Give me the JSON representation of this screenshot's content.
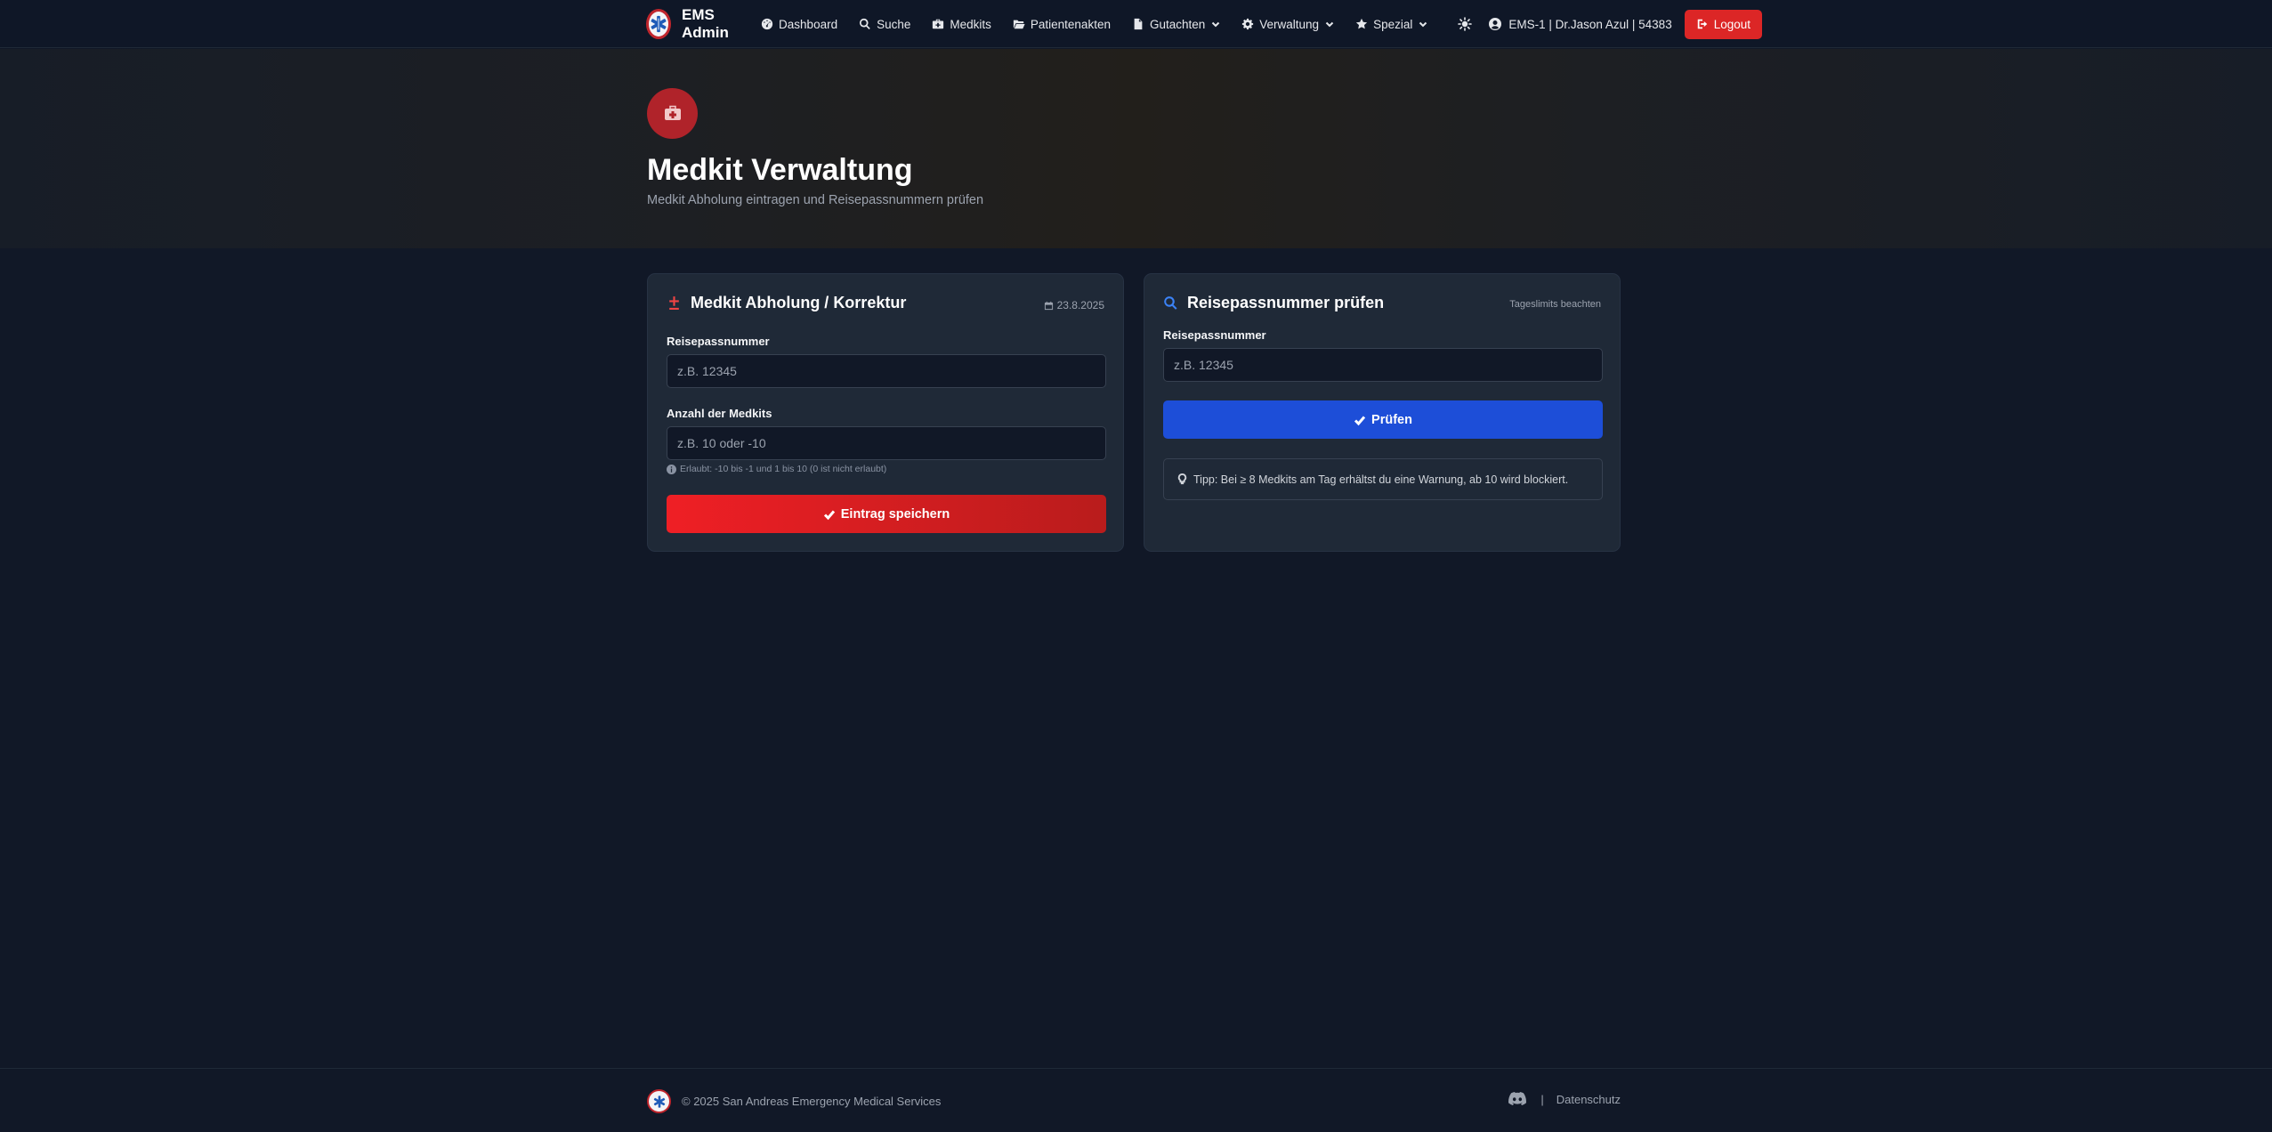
{
  "nav": {
    "brand": "EMS Admin",
    "links": [
      {
        "label": "Dashboard"
      },
      {
        "label": "Suche"
      },
      {
        "label": "Medkits"
      },
      {
        "label": "Patientenakten"
      },
      {
        "label": "Gutachten"
      },
      {
        "label": "Verwaltung"
      },
      {
        "label": "Spezial"
      }
    ],
    "user": "EMS-1 | Dr.Jason Azul | 54383",
    "logout": "Logout"
  },
  "hero": {
    "title": "Medkit Verwaltung",
    "subtitle": "Medkit Abholung eintragen und Reisepassnummern prüfen"
  },
  "left_card": {
    "title": "Medkit Abholung / Korrektur",
    "date": "23.8.2025",
    "passport_label": "Reisepassnummer",
    "passport_placeholder": "z.B. 12345",
    "count_label": "Anzahl der Medkits",
    "count_placeholder": "z.B. 10 oder -10",
    "hint": "Erlaubt: -10 bis -1 und 1 bis 10 (0 ist nicht erlaubt)",
    "submit": "Eintrag speichern"
  },
  "right_card": {
    "title": "Reisepassnummer prüfen",
    "meta": "Tageslimits beachten",
    "passport_label": "Reisepassnummer",
    "passport_placeholder": "z.B. 12345",
    "check": "Prüfen",
    "tip": "Tipp: Bei ≥ 8 Medkits am Tag erhältst du eine Warnung, ab 10 wird blockiert."
  },
  "footer": {
    "copyright": "© 2025 San Andreas Emergency Medical Services",
    "separator": "|",
    "privacy": "Datenschutz"
  },
  "colors": {
    "background": "#111827",
    "card": "#1f2937",
    "primary_red": "#dc2626",
    "primary_blue": "#1d4ed8"
  },
  "icons": {
    "brand": "star-of-life-icon",
    "dashboard": "gauge-icon",
    "search": "search-icon",
    "medkits": "medkit-icon",
    "patients": "folder-open-icon",
    "reports": "file-icon",
    "admin": "gear-icon",
    "special": "star-icon",
    "theme": "sun-icon",
    "user": "user-circle-icon",
    "logout": "sign-out-icon",
    "discord": "discord-icon"
  }
}
